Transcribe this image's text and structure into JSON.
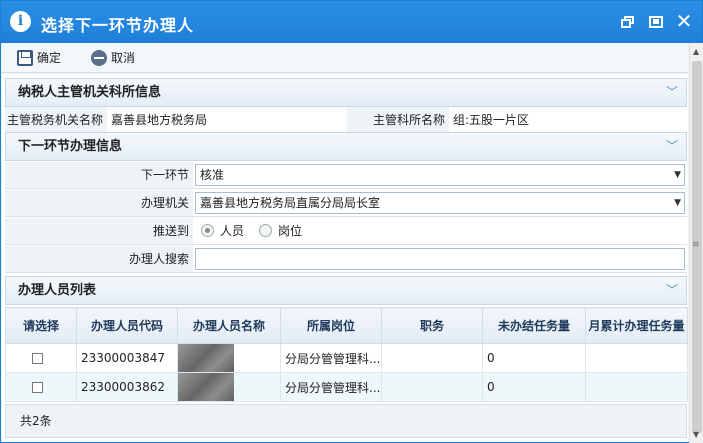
{
  "window": {
    "title": "选择下一环节办理人"
  },
  "toolbar": {
    "ok_label": "确定",
    "cancel_label": "取消"
  },
  "section_tax": {
    "title": "纳税人主管机关科所信息",
    "org_label": "主管税务机关名称",
    "org_value": "嘉善县地方税务局",
    "dept_label": "主管科所名称",
    "dept_value": "组:五股一片区"
  },
  "section_next": {
    "title": "下一环节办理信息",
    "step_label": "下一环节",
    "step_value": "核准",
    "org_label": "办理机关",
    "org_value": "嘉善县地方税务局直属分局局长室",
    "push_label": "推送到",
    "push_options": [
      "人员",
      "岗位"
    ],
    "search_label": "办理人搜索",
    "search_value": ""
  },
  "staff_list": {
    "title": "办理人员列表",
    "columns": [
      "请选择",
      "办理人员代码",
      "办理人员名称",
      "所属岗位",
      "职务",
      "未办结任务量",
      "月累计办理任务量"
    ],
    "rows": [
      {
        "code": "23300003847",
        "post": "分局分管管理科...",
        "duty": "",
        "pending": "0",
        "monthly": ""
      },
      {
        "code": "23300003862",
        "post": "分局分管管理科...",
        "duty": "",
        "pending": "0",
        "monthly": ""
      }
    ],
    "total": "共2条"
  }
}
